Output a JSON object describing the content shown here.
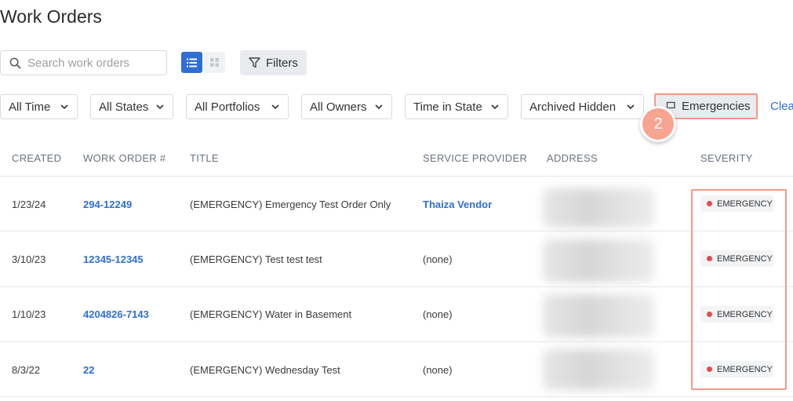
{
  "page": {
    "title": "Work Orders"
  },
  "search": {
    "placeholder": "Search work orders",
    "value": ""
  },
  "toolbar": {
    "filters_label": "Filters"
  },
  "filters": {
    "time": "All Time",
    "states": "All States",
    "portfolios": "All Portfolios",
    "owners": "All Owners",
    "time_in_state": "Time in State",
    "archived": "Archived Hidden",
    "emergencies": "Emergencies",
    "clear": "Clea"
  },
  "annotation": {
    "step": "2",
    "color": "#f29a86"
  },
  "table": {
    "headers": {
      "created": "CREATED",
      "work_order": "WORK ORDER #",
      "title": "TITLE",
      "service_provider": "SERVICE PROVIDER",
      "address": "ADDRESS",
      "severity": "SEVERITY"
    },
    "rows": [
      {
        "created": "1/23/24",
        "work_order": "294-12249",
        "title": "(EMERGENCY) Emergency Test Order Only",
        "service_provider": "Thaiza Vendor",
        "severity": "EMERGENCY"
      },
      {
        "created": "3/10/23",
        "work_order": "12345-12345",
        "title": "(EMERGENCY) Test test test",
        "service_provider": "(none)",
        "severity": "EMERGENCY"
      },
      {
        "created": "1/10/23",
        "work_order": "4204826-7143",
        "title": "(EMERGENCY) Water in Basement",
        "service_provider": "(none)",
        "severity": "EMERGENCY"
      },
      {
        "created": "8/3/22",
        "work_order": "22",
        "title": "(EMERGENCY) Wednesday Test",
        "service_provider": "(none)",
        "severity": "EMERGENCY"
      }
    ]
  },
  "colors": {
    "accent": "#2f6fd1",
    "emergency_dot": "#e44c4c"
  }
}
